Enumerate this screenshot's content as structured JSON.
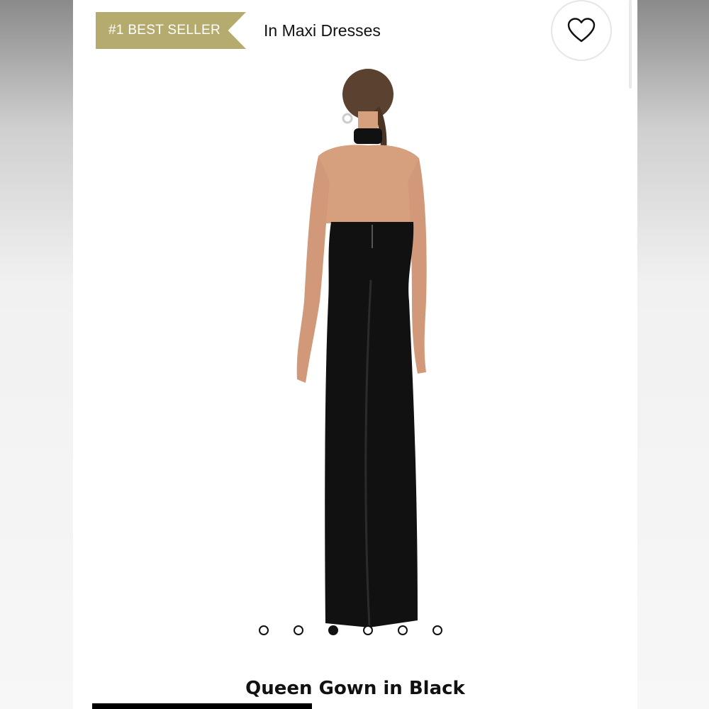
{
  "header": {
    "badge_label": "#1 BEST SELLER",
    "category_label": "In Maxi Dresses",
    "favorite_icon": "heart-outline-icon"
  },
  "product": {
    "title": "Queen Gown in Black",
    "image_description_icon": "product-photo",
    "gallery": {
      "total_images": 6,
      "active_index": 2
    }
  },
  "colors": {
    "badge": "#b6ab6e",
    "dress": "#111111",
    "skin": "#d6a07f",
    "hair": "#5a4130"
  }
}
